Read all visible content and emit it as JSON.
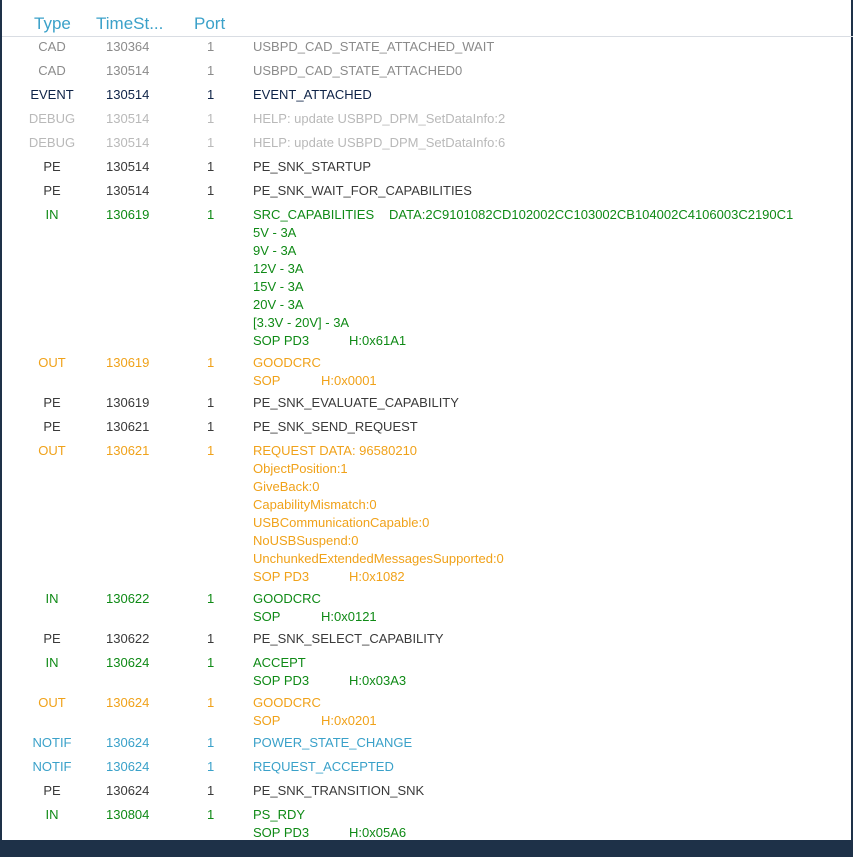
{
  "columns": {
    "type": "Type",
    "timestamp": "TimeSt...",
    "port": "Port"
  },
  "rows": [
    {
      "type": "CAD",
      "ts": "130364",
      "port": "1",
      "cls": "cad",
      "lines": [
        "USBPD_CAD_STATE_ATTACHED_WAIT"
      ]
    },
    {
      "type": "CAD",
      "ts": "130514",
      "port": "1",
      "cls": "cad",
      "lines": [
        "USBPD_CAD_STATE_ATTACHED0"
      ]
    },
    {
      "type": "EVENT",
      "ts": "130514",
      "port": "1",
      "cls": "event",
      "lines": [
        "EVENT_ATTACHED"
      ]
    },
    {
      "type": "DEBUG",
      "ts": "130514",
      "port": "1",
      "cls": "debug",
      "lines": [
        "HELP: update USBPD_DPM_SetDataInfo:2"
      ]
    },
    {
      "type": "DEBUG",
      "ts": "130514",
      "port": "1",
      "cls": "debug",
      "lines": [
        "HELP: update USBPD_DPM_SetDataInfo:6"
      ]
    },
    {
      "type": "PE",
      "ts": "130514",
      "port": "1",
      "cls": "pe",
      "lines": [
        "PE_SNK_STARTUP"
      ]
    },
    {
      "type": "PE",
      "ts": "130514",
      "port": "1",
      "cls": "pe",
      "lines": [
        "PE_SNK_WAIT_FOR_CAPABILITIES"
      ]
    },
    {
      "type": "IN",
      "ts": "130619",
      "port": "1",
      "cls": "in",
      "lines": [
        [
          "SRC_CAPABILITIES",
          "DATA:2C9101082CD102002CC103002CB104002C4106003C2190C1"
        ],
        "5V - 3A",
        "9V - 3A",
        "12V - 3A",
        "15V - 3A",
        "20V - 3A",
        "[3.3V - 20V] - 3A",
        [
          "SOP PD3",
          "H:0x61A1"
        ]
      ]
    },
    {
      "type": "OUT",
      "ts": "130619",
      "port": "1",
      "cls": "out",
      "lines": [
        "GOODCRC",
        [
          "SOP",
          "H:0x0001"
        ]
      ]
    },
    {
      "type": "PE",
      "ts": "130619",
      "port": "1",
      "cls": "pe",
      "lines": [
        "PE_SNK_EVALUATE_CAPABILITY"
      ]
    },
    {
      "type": "PE",
      "ts": "130621",
      "port": "1",
      "cls": "pe",
      "lines": [
        "PE_SNK_SEND_REQUEST"
      ]
    },
    {
      "type": "OUT",
      "ts": "130621",
      "port": "1",
      "cls": "out",
      "lines": [
        "REQUEST DATA: 96580210",
        "ObjectPosition:1",
        "GiveBack:0",
        "CapabilityMismatch:0",
        "USBCommunicationCapable:0",
        "NoUSBSuspend:0",
        "UnchunkedExtendedMessagesSupported:0",
        [
          "SOP PD3",
          "H:0x1082"
        ]
      ]
    },
    {
      "type": "IN",
      "ts": "130622",
      "port": "1",
      "cls": "in",
      "lines": [
        "GOODCRC",
        [
          "SOP",
          "H:0x0121"
        ]
      ]
    },
    {
      "type": "PE",
      "ts": "130622",
      "port": "1",
      "cls": "pe",
      "lines": [
        "PE_SNK_SELECT_CAPABILITY"
      ]
    },
    {
      "type": "IN",
      "ts": "130624",
      "port": "1",
      "cls": "in",
      "lines": [
        "ACCEPT",
        [
          "SOP PD3",
          "H:0x03A3"
        ]
      ]
    },
    {
      "type": "OUT",
      "ts": "130624",
      "port": "1",
      "cls": "out",
      "lines": [
        "GOODCRC",
        [
          "SOP",
          "H:0x0201"
        ]
      ]
    },
    {
      "type": "NOTIF",
      "ts": "130624",
      "port": "1",
      "cls": "notif",
      "lines": [
        "POWER_STATE_CHANGE"
      ]
    },
    {
      "type": "NOTIF",
      "ts": "130624",
      "port": "1",
      "cls": "notif",
      "lines": [
        "REQUEST_ACCEPTED"
      ]
    },
    {
      "type": "PE",
      "ts": "130624",
      "port": "1",
      "cls": "pe",
      "lines": [
        "PE_SNK_TRANSITION_SNK"
      ]
    },
    {
      "type": "IN",
      "ts": "130804",
      "port": "1",
      "cls": "in",
      "lines": [
        "PS_RDY",
        [
          "SOP PD3",
          "H:0x05A6"
        ]
      ]
    }
  ]
}
